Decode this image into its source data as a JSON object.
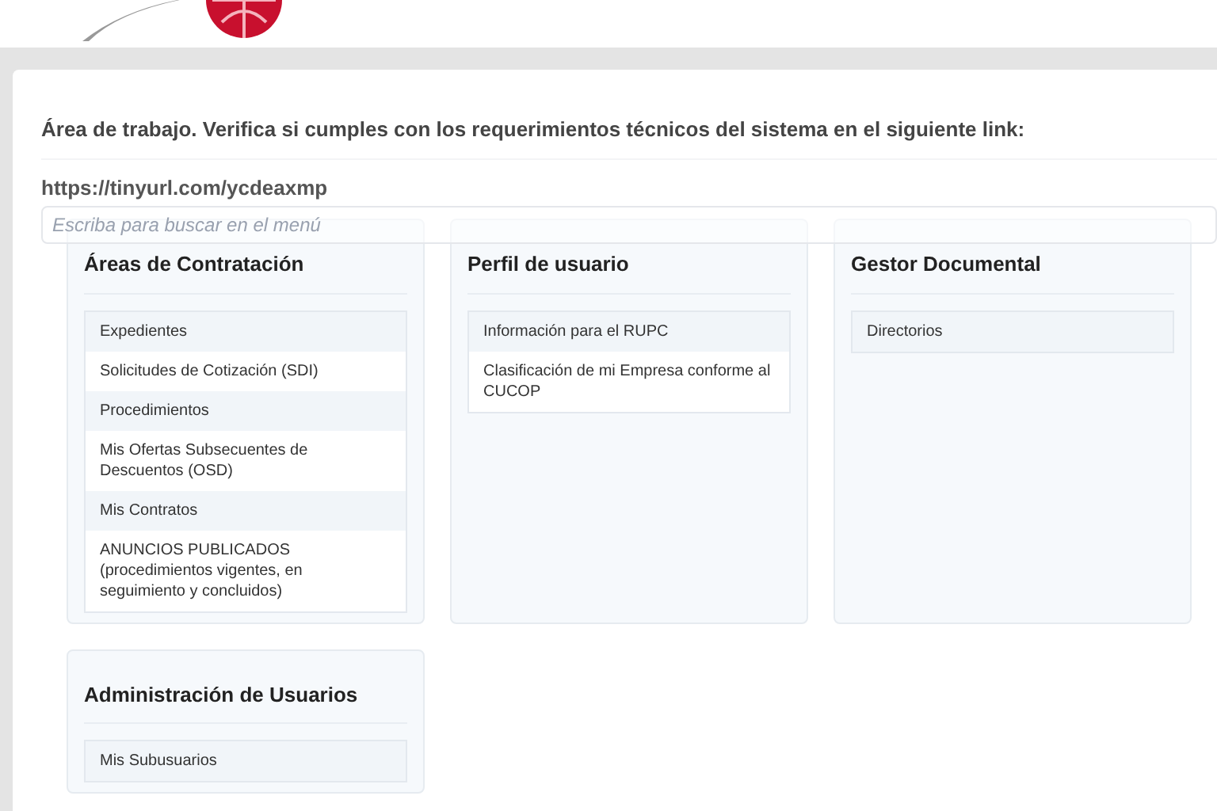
{
  "notice": "Área de trabajo. Verifica si cumples con los requerimientos técnicos del sistema en el siguiente link:",
  "link": "https://tinyurl.com/ycdeaxmp",
  "search": {
    "placeholder": "Escriba para buscar en el menú"
  },
  "cards": [
    {
      "title": "Áreas de Contratación",
      "items": [
        "Expedientes",
        "Solicitudes de Cotización (SDI)",
        "Procedimientos",
        "Mis Ofertas Subsecuentes de Descuentos (OSD)",
        "Mis Contratos",
        "ANUNCIOS PUBLICADOS (procedimientos vigentes, en seguimiento y concluidos)"
      ]
    },
    {
      "title": "Perfil de usuario",
      "items": [
        "Información para el RUPC",
        "Clasificación de mi Empresa conforme al CUCOP"
      ]
    },
    {
      "title": "Gestor Documental",
      "items": [
        "Directorios"
      ]
    },
    {
      "title": "Administración de Usuarios",
      "items": [
        "Mis Subusuarios"
      ]
    }
  ]
}
